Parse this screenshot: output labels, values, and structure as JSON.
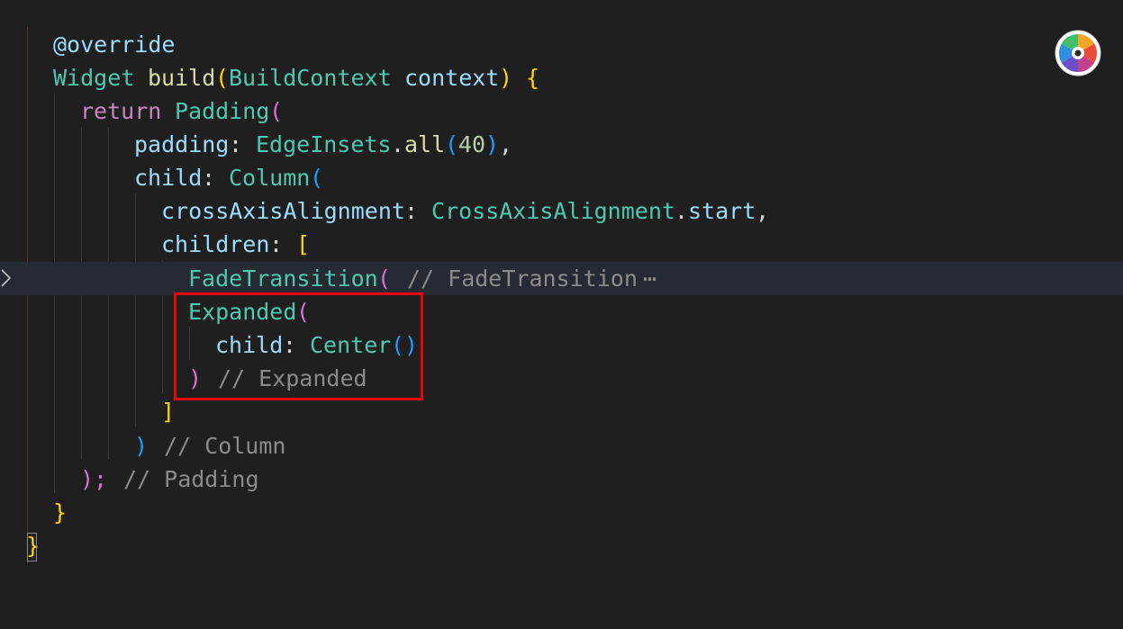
{
  "editor": {
    "lines": [
      {
        "annotation": "@override"
      },
      {
        "type": "Widget",
        "fn": "build",
        "open": "(",
        "param_type": "BuildContext",
        "param": "context",
        "close": ")",
        "brace": "{"
      },
      {
        "kw": "return",
        "type": "Padding",
        "open": "("
      },
      {
        "prop": "padding",
        "colon": ":",
        "type": "EdgeInsets",
        "dot": ".",
        "fn": "all",
        "open": "(",
        "num": "40",
        "close": ")",
        "comma": ","
      },
      {
        "prop": "child",
        "colon": ":",
        "type": "Column",
        "open": "("
      },
      {
        "prop": "crossAxisAlignment",
        "colon": ":",
        "type": "CrossAxisAlignment",
        "dot": ".",
        "member": "start",
        "comma": ","
      },
      {
        "prop": "children",
        "colon": ":",
        "open": "["
      },
      {
        "type": "FadeTransition",
        "open": "(",
        "comment": "// FadeTransition",
        "ellipsis": "⋯"
      },
      {
        "type": "Expanded",
        "open": "("
      },
      {
        "prop": "child",
        "colon": ":",
        "type": "Center",
        "parens": "()"
      },
      {
        "close": ")",
        "comment": "// Expanded"
      },
      {
        "close": "]"
      },
      {
        "close": ")",
        "comment": "// Column"
      },
      {
        "close": ");",
        "comment": "// Padding"
      },
      {
        "close": "}"
      },
      {
        "close": "}"
      }
    ]
  },
  "colors": {
    "background": "#1f1f1f",
    "highlight_box": "#e8060b",
    "type": "#4ec9b0",
    "function": "#dcdcaa",
    "variable": "#9cdcfe",
    "keyword": "#c586c0",
    "comment": "#8b8b8b"
  },
  "icons": {
    "fold": "chevron-right-icon",
    "app": "color-wheel-icon"
  }
}
